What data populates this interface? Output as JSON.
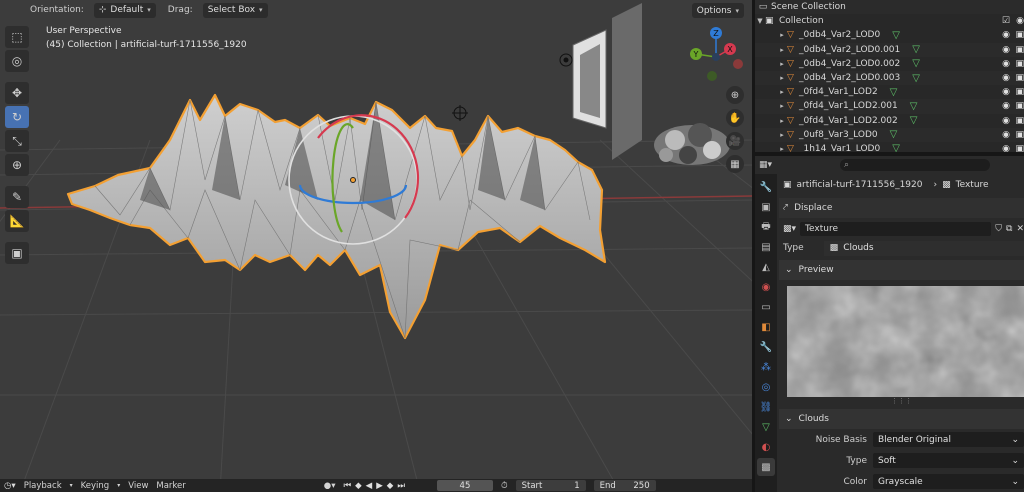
{
  "viewport_header": {
    "orientation_label": "Orientation:",
    "orientation_value": "Default",
    "drag_label": "Drag:",
    "drag_value": "Select Box",
    "options_label": "Options"
  },
  "viewport": {
    "view_name": "User Perspective",
    "view_detail": "(45) Collection | artificial-turf-1711556_1920"
  },
  "gizmo_axes": {
    "x": "X",
    "y": "Y",
    "z": "Z"
  },
  "timeline": {
    "playback": "Playback",
    "keying": "Keying",
    "view": "View",
    "marker": "Marker",
    "frame": "45",
    "start_label": "Start",
    "start": "1",
    "end_label": "End",
    "end": "250"
  },
  "outliner": {
    "scene_collection": "Scene Collection",
    "collection": "Collection",
    "items": [
      "_0db4_Var2_LOD0",
      "_0db4_Var2_LOD0.001",
      "_0db4_Var2_LOD0.002",
      "_0db4_Var2_LOD0.003",
      "_0fd4_Var1_LOD2",
      "_0fd4_Var1_LOD2.001",
      "_0fd4_Var1_LOD2.002",
      "_0uf8_Var3_LOD0",
      "_1h14_Var1_LOD0"
    ]
  },
  "properties": {
    "breadcrumb_object": "artificial-turf-1711556_1920",
    "breadcrumb_tab": "Texture",
    "modifier_name": "Displace",
    "texture_name": "Texture",
    "type_label": "Type",
    "type_value": "Clouds",
    "preview_header": "Preview",
    "clouds_header": "Clouds",
    "noise_basis_label": "Noise Basis",
    "noise_basis_value": "Blender Original",
    "type2_label": "Type",
    "type2_value": "Soft",
    "color_label": "Color",
    "color_value": "Grayscale"
  },
  "colors": {
    "accent": "#4772b3",
    "selection_outline": "#f3a033",
    "axis_x": "#d6394f",
    "axis_y": "#6aa628",
    "axis_z": "#2f7bd6"
  }
}
